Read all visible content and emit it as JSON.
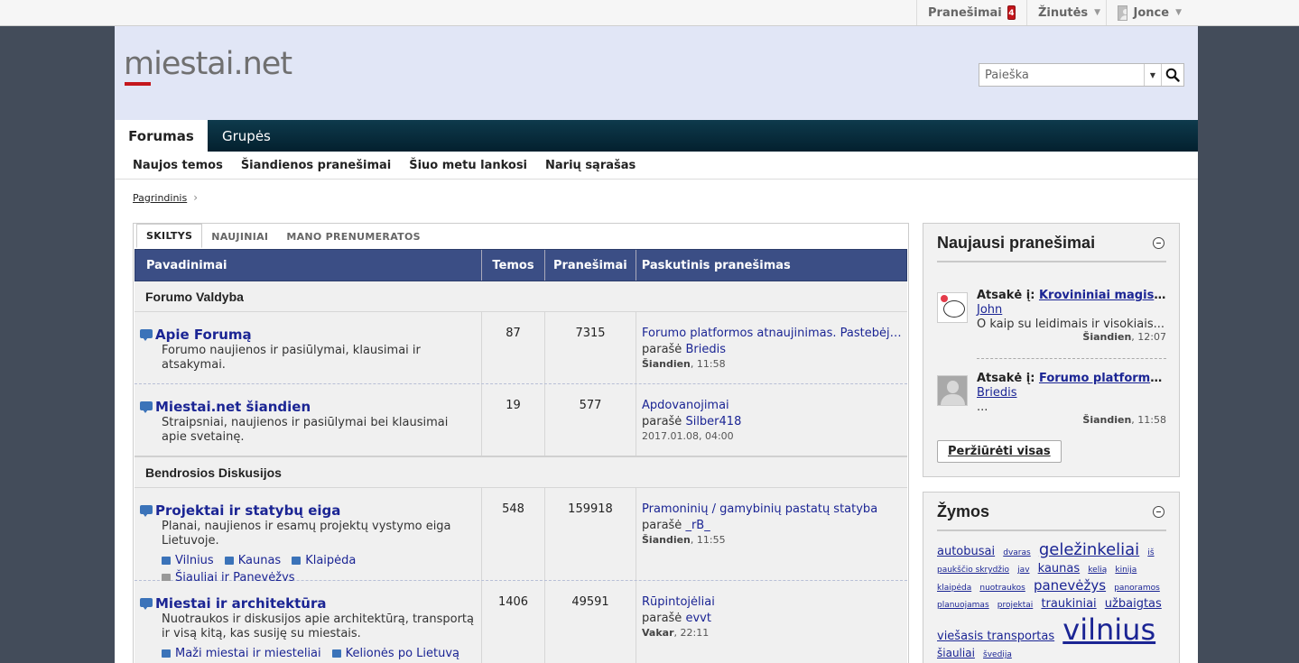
{
  "topbar": {
    "notifications_label": "Pranešimai",
    "notifications_count": "4",
    "messages_label": "Žinutės",
    "user_name": "Jonce"
  },
  "header": {
    "logo_text": "miestai.net",
    "search_placeholder": "Paieška"
  },
  "nav": {
    "tabs": [
      {
        "label": "Forumas"
      },
      {
        "label": "Grupės"
      }
    ],
    "sublinks": [
      {
        "label": "Naujos temos"
      },
      {
        "label": "Šiandienos pranešimai"
      },
      {
        "label": "Šiuo metu lankosi"
      },
      {
        "label": "Narių sąrašas"
      }
    ]
  },
  "breadcrumb": {
    "home": "Pagrindinis"
  },
  "forum": {
    "tabs": [
      {
        "label": "SKILTYS"
      },
      {
        "label": "NAUJINIAI"
      },
      {
        "label": "MANO PRENUMERATOS"
      }
    ],
    "columns": {
      "name": "Pavadinimai",
      "topics": "Temos",
      "posts": "Pranešimai",
      "last": "Paskutinis pranešimas"
    },
    "categories": [
      {
        "title": "Forumo Valdyba",
        "forums": [
          {
            "title": "Apie Forumą",
            "desc": "Forumo naujienos ir pasiūlymai, klausimai ir atsakymai.",
            "topics": "87",
            "posts": "7315",
            "last_title": "Forumo platformos atnaujinimas. Pastebėjimai, klausimai",
            "last_by_prefix": "parašė",
            "last_by": "Briedis",
            "last_day": "Šiandien",
            "last_time": ", 11:58"
          },
          {
            "title": "Miestai.net šiandien",
            "desc": "Straipsniai, naujienos ir pasiūlymai bei klausimai apie svetainę.",
            "topics": "19",
            "posts": "577",
            "last_title": "Apdovanojimai",
            "last_by_prefix": "parašė",
            "last_by": "Silber418",
            "last_day": "",
            "last_time": "2017.01.08, 04:00"
          }
        ]
      },
      {
        "title": "Bendrosios Diskusijos",
        "forums": [
          {
            "title": "Projektai ir statybų eiga",
            "desc": "Planai, naujienos ir esamų projektų vystymo eiga Lietuvoje.",
            "subs": [
              "Vilnius",
              "Kaunas",
              "Klaipėda",
              "Šiauliai ir Panevėžys"
            ],
            "topics": "548",
            "posts": "159918",
            "last_title": "Pramoninių / gamybinių pastatų statyba",
            "last_by_prefix": "parašė",
            "last_by": "_rB_",
            "last_day": "Šiandien",
            "last_time": ", 11:55"
          },
          {
            "title": "Miestai ir architektūra",
            "desc": "Nuotraukos ir diskusijos apie architektūrą, transportą ir visą kitą, kas susiję su miestais.",
            "subs": [
              "Maži miestai ir miesteliai",
              "Kelionės po Lietuvą"
            ],
            "topics": "1406",
            "posts": "49591",
            "last_title": "Rūpintojėliai",
            "last_by_prefix": "parašė",
            "last_by": "evvt",
            "last_day": "Vakar",
            "last_time": ", 22:11"
          }
        ]
      }
    ]
  },
  "sidebar": {
    "latest": {
      "title": "Naujausi pranešimai",
      "posts": [
        {
          "prefix": "Atsakė į:",
          "thread": "Krovininiai magistraliniai traukiniai",
          "author": "John",
          "excerpt": "O kaip su leidimais ir visokiais...",
          "day": "Šiandien",
          "time": ", 12:07"
        },
        {
          "prefix": "Atsakė į:",
          "thread": "Forumo platformos atnaujinimas",
          "author": "Briedis",
          "excerpt": "...",
          "day": "Šiandien",
          "time": ", 11:58"
        }
      ],
      "view_all": "Peržiūrėti visas"
    },
    "tags": {
      "title": "Žymos",
      "items": [
        {
          "label": "autobusai",
          "size": 13
        },
        {
          "label": "dvaras",
          "size": 9
        },
        {
          "label": "geležinkeliai",
          "size": 18
        },
        {
          "label": "iš",
          "size": 9
        },
        {
          "label": "paukščio skrydžio",
          "size": 9
        },
        {
          "label": "jav",
          "size": 9
        },
        {
          "label": "kaunas",
          "size": 13
        },
        {
          "label": "kelią",
          "size": 9
        },
        {
          "label": "kinija",
          "size": 9
        },
        {
          "label": "klaipėda",
          "size": 9
        },
        {
          "label": "nuotraukos",
          "size": 9
        },
        {
          "label": "panevėžys",
          "size": 15
        },
        {
          "label": "panoramos",
          "size": 9
        },
        {
          "label": "planuojamas",
          "size": 9
        },
        {
          "label": "projektai",
          "size": 9
        },
        {
          "label": "traukiniai",
          "size": 13
        },
        {
          "label": "užbaigtas",
          "size": 13
        },
        {
          "label": "viešasis transportas",
          "size": 13
        },
        {
          "label": "vilnius",
          "size": 32
        },
        {
          "label": "šiauliai",
          "size": 12
        },
        {
          "label": "švedija",
          "size": 9
        }
      ]
    }
  }
}
